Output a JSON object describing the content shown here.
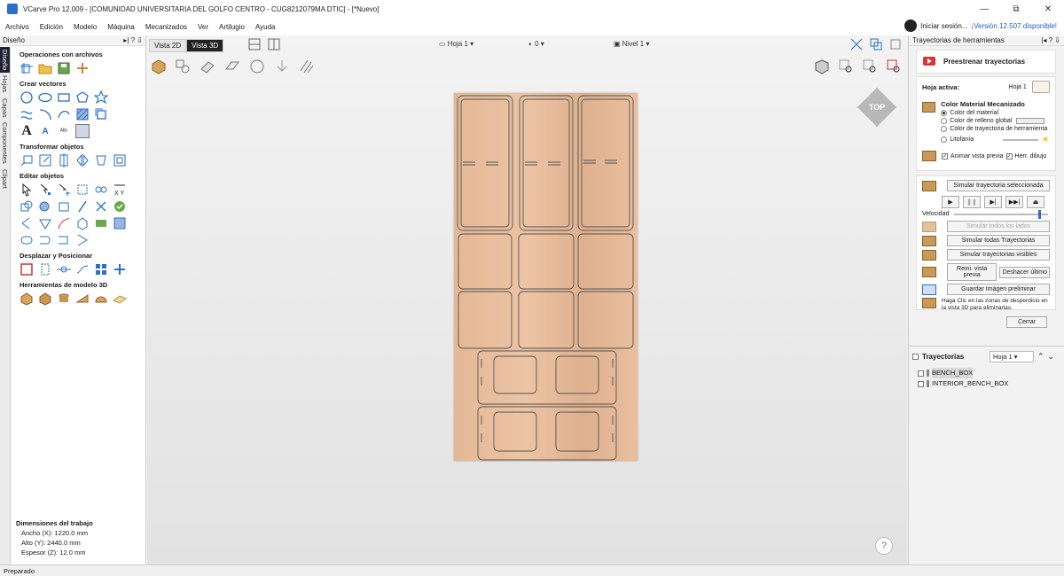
{
  "titlebar": {
    "title": "VCarve Pro 12.009 - [COMUNIDAD UNIVERSITARIA DEL GOLFO CENTRO - CUG8212079MA DTIC] - [*Nuevo]",
    "min": "—",
    "max": "⧉",
    "close": "✕"
  },
  "menu": {
    "items": [
      "Archivo",
      "Edición",
      "Modelo",
      "Máquina",
      "Mecanizados",
      "Ver",
      "Artilugio",
      "Ayuda"
    ],
    "signin": "Iniciar sesión...",
    "update": "¡Versión 12.507 disponible!"
  },
  "left": {
    "title": "Diseño",
    "vtabs": [
      "Diseño",
      "Hojas",
      "Capas",
      "Componentes",
      "Clipart"
    ],
    "sections": [
      "Operaciones con archivos",
      "Crear vectores",
      "Transformar objetos",
      "Editar objetos",
      "Desplazar y Posicionar",
      "Herramientas de modelo 3D"
    ],
    "dims_title": "Dimensiones del trabajo",
    "width": "Ancho   (X): 1220.0 mm",
    "height": "Alto    (Y): 2440.0 mm",
    "thickness": "Espesor (Z): 12.0 mm"
  },
  "view": {
    "tab2d": "Vista 2D",
    "tab3d": "Vista 3D",
    "sheet": "Hoja 1",
    "rot": "0",
    "level": "Nivel 1",
    "cube": "TOP",
    "help": "?"
  },
  "right": {
    "title": "Trayectorias de herramientas",
    "preview_title": "Preestrenar trayectorias",
    "active_sheet_label": "Hoja activa:",
    "active_sheet": "Hoja 1",
    "color_title": "Color Material Mecanizado",
    "radios": [
      "Color del material",
      "Color de relleno global",
      "Color de trayectoria de herramienta",
      "Litofanía"
    ],
    "animate": "Animar vista previa",
    "draw_tool": "Herr. dibujo",
    "sim_selected": "Simular trayectoria seleccionada",
    "speed": "Velocidad",
    "sim_all_layers": "Simular todos los lados",
    "sim_all": "Simular todas Trayectorias",
    "sim_visible": "Simular trayectorias visibles",
    "reset": "Reini. vista previa",
    "undo": "Deshacer último",
    "save_img": "Guardar Imágen preliminar",
    "hint": "Haga Clic en las zonas de desperdicio en la vista 3D para eliminarlas.",
    "close": "Cerrar",
    "toolpaths_label": "Trayectorias",
    "toolpaths_sheet": "Hoja 1",
    "toolpaths": [
      "BENCH_BOX",
      "INTERIOR_BENCH_BOX"
    ]
  },
  "status": "Preparado"
}
